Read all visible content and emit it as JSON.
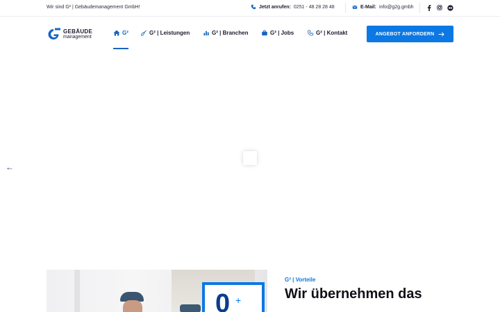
{
  "topbar": {
    "tagline": "Wir sind G² | Gebäudemanagement GmbH!",
    "phone_label": "Jetzt anrufen:",
    "phone_value": "0251 - 48 28 28 48",
    "email_label": "E-Mail:",
    "email_value": "info@g2g.gmbh",
    "social": [
      "facebook-icon",
      "instagram-icon",
      "flickr-icon"
    ]
  },
  "logo": {
    "line1": "GEBÄUDE",
    "line2": "management"
  },
  "nav": {
    "items": [
      {
        "label": "G²",
        "icon": "home-icon"
      },
      {
        "label": "G² | Leistungen",
        "icon": "broom-icon"
      },
      {
        "label": "G² | Branchen",
        "icon": "chart-icon"
      },
      {
        "label": "G² | Jobs",
        "icon": "briefcase-icon"
      },
      {
        "label": "G² | Kontakt",
        "icon": "phone-icon"
      }
    ],
    "cta_label": "ANGEBOT ANFORDERN"
  },
  "slider": {
    "prev_arrow": "←"
  },
  "section": {
    "counter": "0",
    "counter_suffix": "+",
    "kicker": "G² | Vorteile",
    "title": "Wir übernehmen das"
  },
  "colors": {
    "accent": "#0b78e3",
    "active_nav": "#1565c0",
    "text": "#1b1b2f"
  }
}
